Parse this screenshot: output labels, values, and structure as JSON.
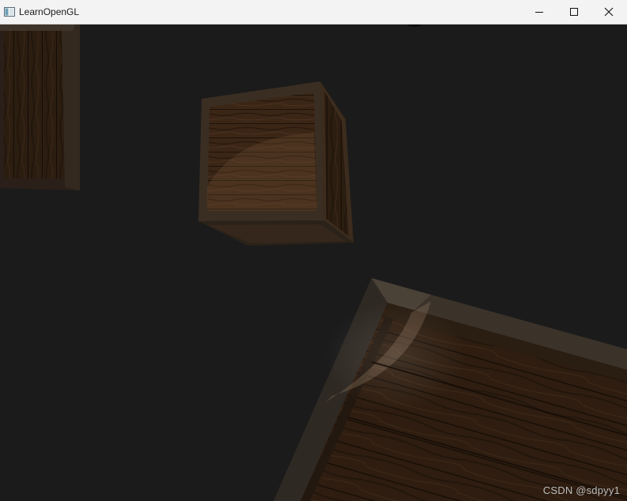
{
  "window": {
    "title": "LearnOpenGL",
    "controls": [
      "minimize-icon",
      "maximize-icon",
      "close-icon"
    ]
  },
  "scene": {
    "description_objects": [
      "wooden-crate",
      "wooden-crate",
      "wooden-crate"
    ],
    "background_color": "#1b1b1b"
  },
  "watermark": {
    "text": "CSDN @sdpyy1"
  }
}
